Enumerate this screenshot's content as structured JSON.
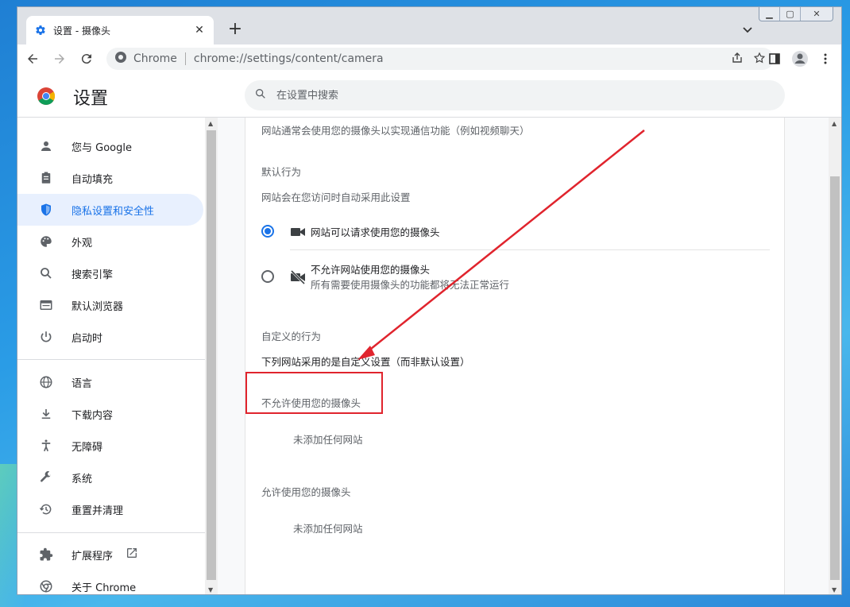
{
  "tab": {
    "title": "设置 - 摄像头",
    "close": "✕",
    "new_tab": "+"
  },
  "omnibox": {
    "site": "Chrome",
    "url": "chrome://settings/content/camera"
  },
  "header": {
    "title": "设置",
    "search_placeholder": "在设置中搜索"
  },
  "sidebar": {
    "items": [
      {
        "label": "您与 Google",
        "icon": "person-icon"
      },
      {
        "label": "自动填充",
        "icon": "clipboard-icon"
      },
      {
        "label": "隐私设置和安全性",
        "icon": "shield-icon",
        "active": true
      },
      {
        "label": "外观",
        "icon": "palette-icon"
      },
      {
        "label": "搜索引擎",
        "icon": "search-icon"
      },
      {
        "label": "默认浏览器",
        "icon": "browser-icon"
      },
      {
        "label": "启动时",
        "icon": "power-icon"
      },
      {
        "label": "语言",
        "icon": "globe-icon"
      },
      {
        "label": "下载内容",
        "icon": "download-icon"
      },
      {
        "label": "无障碍",
        "icon": "accessibility-icon"
      },
      {
        "label": "系统",
        "icon": "wrench-icon"
      },
      {
        "label": "重置并清理",
        "icon": "history-icon"
      },
      {
        "label": "扩展程序",
        "icon": "puzzle-icon"
      },
      {
        "label": "关于 Chrome",
        "icon": "chrome-icon"
      }
    ]
  },
  "main": {
    "intro": "网站通常会使用您的摄像头以实现通信功能（例如视频聊天）",
    "default_heading": "默认行为",
    "default_desc": "网站会在您访问时自动采用此设置",
    "option_allow": "网站可以请求使用您的摄像头",
    "option_block": "不允许网站使用您的摄像头",
    "option_block_desc": "所有需要使用摄像头的功能都将无法正常运行",
    "custom_heading": "自定义的行为",
    "custom_desc": "下列网站采用的是自定义设置（而非默认设置）",
    "blocked_heading": "不允许使用您的摄像头",
    "blocked_empty": "未添加任何网站",
    "allowed_heading": "允许使用您的摄像头",
    "allowed_empty": "未添加任何网站"
  },
  "colors": {
    "accent": "#1a73e8",
    "annotation": "#e0242d"
  }
}
